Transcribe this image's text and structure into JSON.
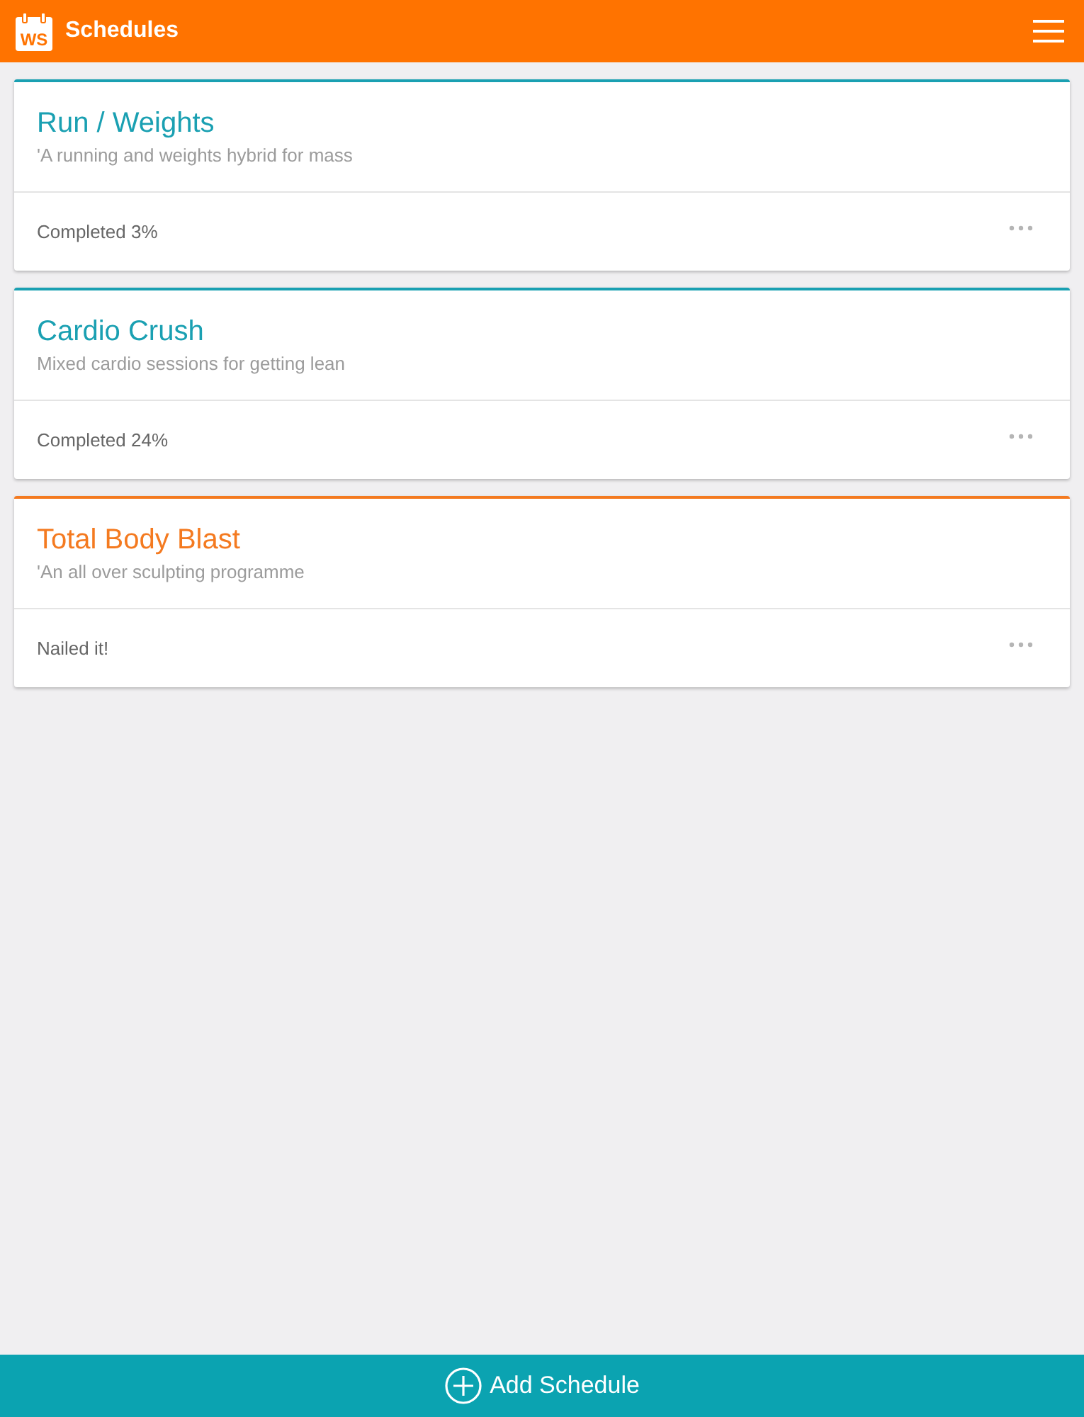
{
  "header": {
    "logo_text": "WS",
    "title": "Schedules"
  },
  "schedules": [
    {
      "title": "Run / Weights",
      "description": "'A running and weights hybrid for mass",
      "status": "Completed 3%",
      "color": "#1aa0b2"
    },
    {
      "title": "Cardio Crush",
      "description": "Mixed cardio sessions for getting lean",
      "status": "Completed 24%",
      "color": "#1aa0b2"
    },
    {
      "title": "Total Body Blast",
      "description": "'An all over sculpting programme",
      "status": "Nailed it!",
      "color": "#f47a20"
    }
  ],
  "add_button": {
    "label": "Add Schedule"
  }
}
